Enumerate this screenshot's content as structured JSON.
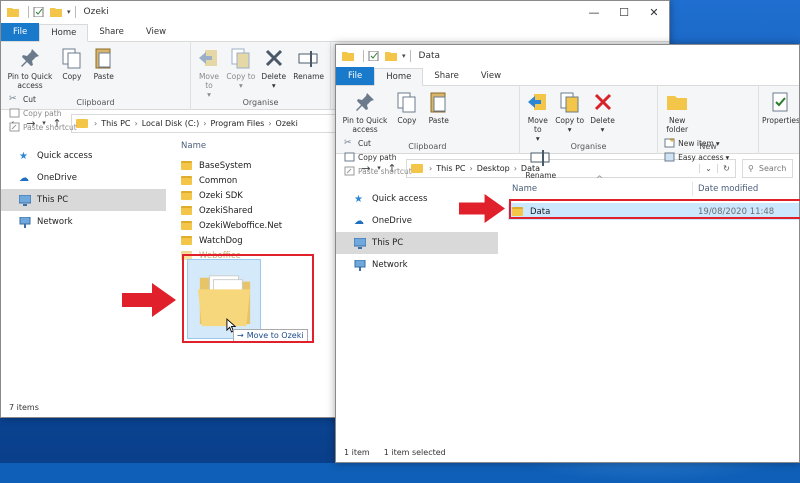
{
  "colors": {
    "accent": "#1979ca",
    "folder": "#f3c548",
    "highlight": "#e0202a",
    "selected_row": "#cce8ff"
  },
  "left_window": {
    "title": "Ozeki",
    "tabs": [
      "File",
      "Home",
      "Share",
      "View"
    ],
    "ribbon": {
      "pin_label": "Pin to Quick access",
      "copy_label": "Copy",
      "paste_label": "Paste",
      "cut_label": "Cut",
      "copy_path_label": "Copy path",
      "paste_shortcut_label": "Paste shortcut",
      "clipboard_group": "Clipboard",
      "move_to_label": "Move to",
      "copy_to_label": "Copy to",
      "delete_label": "Delete",
      "rename_label": "Rename",
      "organise_group": "Organise"
    },
    "breadcrumb": [
      "This PC",
      "Local Disk (C:)",
      "Program Files",
      "Ozeki"
    ],
    "nav": [
      "Quick access",
      "OneDrive",
      "This PC",
      "Network"
    ],
    "column_name": "Name",
    "files": [
      "BaseSystem",
      "Common",
      "Ozeki SDK",
      "OzekiShared",
      "OzekiWeboffice.Net",
      "WatchDog",
      "Weboffice"
    ],
    "drag_tooltip": "Move to Ozeki",
    "status": "7 items"
  },
  "right_window": {
    "title": "Data",
    "tabs": [
      "File",
      "Home",
      "Share",
      "View"
    ],
    "ribbon": {
      "pin_label": "Pin to Quick access",
      "copy_label": "Copy",
      "paste_label": "Paste",
      "cut_label": "Cut",
      "copy_path_label": "Copy path",
      "paste_shortcut_label": "Paste shortcut",
      "clipboard_group": "Clipboard",
      "move_to_label": "Move to",
      "copy_to_label": "Copy to",
      "delete_label": "Delete",
      "rename_label": "Rename",
      "organise_group": "Organise",
      "new_folder_label": "New folder",
      "new_item_label": "New item",
      "easy_access_label": "Easy access",
      "new_group": "New",
      "properties_label": "Properties"
    },
    "breadcrumb": [
      "This PC",
      "Desktop",
      "Data"
    ],
    "search_placeholder": "Search",
    "nav": [
      "Quick access",
      "OneDrive",
      "This PC",
      "Network"
    ],
    "column_name": "Name",
    "column_date": "Date modified",
    "files": [
      {
        "name": "Data",
        "date": "19/08/2020 11:48"
      }
    ],
    "status_items": "1 item",
    "status_selected": "1 item selected"
  }
}
